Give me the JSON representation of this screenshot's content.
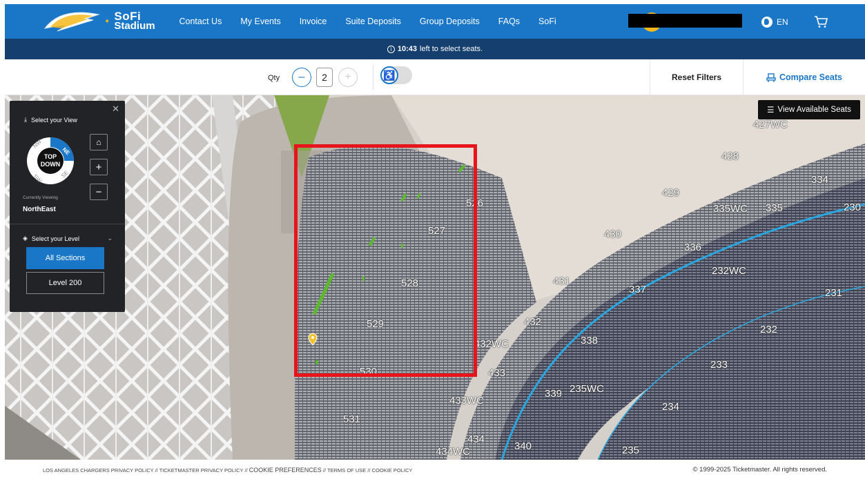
{
  "header": {
    "brand_line1": "SoFi",
    "brand_line2": "Stadium",
    "nav": [
      "Contact Us",
      "My Events",
      "Invoice",
      "Suite Deposits",
      "Group Deposits",
      "FAQs",
      "SoFi"
    ],
    "language": "EN"
  },
  "timer": {
    "time": "10:43",
    "message": "left to select seats."
  },
  "toolbar": {
    "qty_label": "Qty",
    "qty_value": "2",
    "reset_label": "Reset Filters",
    "compare_label": "Compare Seats"
  },
  "panel": {
    "view_title": "Select your View",
    "compass_top": "TOP",
    "compass_bottom": "DOWN",
    "dir_nw": "NW",
    "dir_ne": "NE",
    "dir_sw": "SW",
    "dir_se": "SE",
    "currently_viewing_label": "Currently Viewing",
    "currently_viewing_value": "NorthEast",
    "level_title": "Select your Level",
    "level_all": "All Sections",
    "level_200": "Level 200"
  },
  "map": {
    "view_available": "View Available Seats",
    "sections": [
      "427WC",
      "428",
      "429",
      "334",
      "335WC",
      "335",
      "230",
      "430",
      "336",
      "232WC",
      "526",
      "527",
      "528",
      "529",
      "530",
      "531",
      "431",
      "337",
      "231",
      "432",
      "432WC",
      "338",
      "232",
      "433",
      "233",
      "433WC",
      "339",
      "235WC",
      "234",
      "434",
      "434WC",
      "340",
      "235"
    ],
    "colors": {
      "available": "#5cb82e",
      "pin": "#f2c230",
      "highlight": "#e8141b",
      "accent": "#1a77c8"
    }
  },
  "footer": {
    "links": [
      "LOS ANGELES CHARGERS PRIVACY POLICY",
      "TICKETMASTER PRIVACY POLICY",
      "COOKIE PREFERENCES",
      "TERMS OF USE",
      "COOKIE POLICY"
    ],
    "separator": "//",
    "copyright": "© 1999-2025 Ticketmaster. All rights reserved."
  }
}
